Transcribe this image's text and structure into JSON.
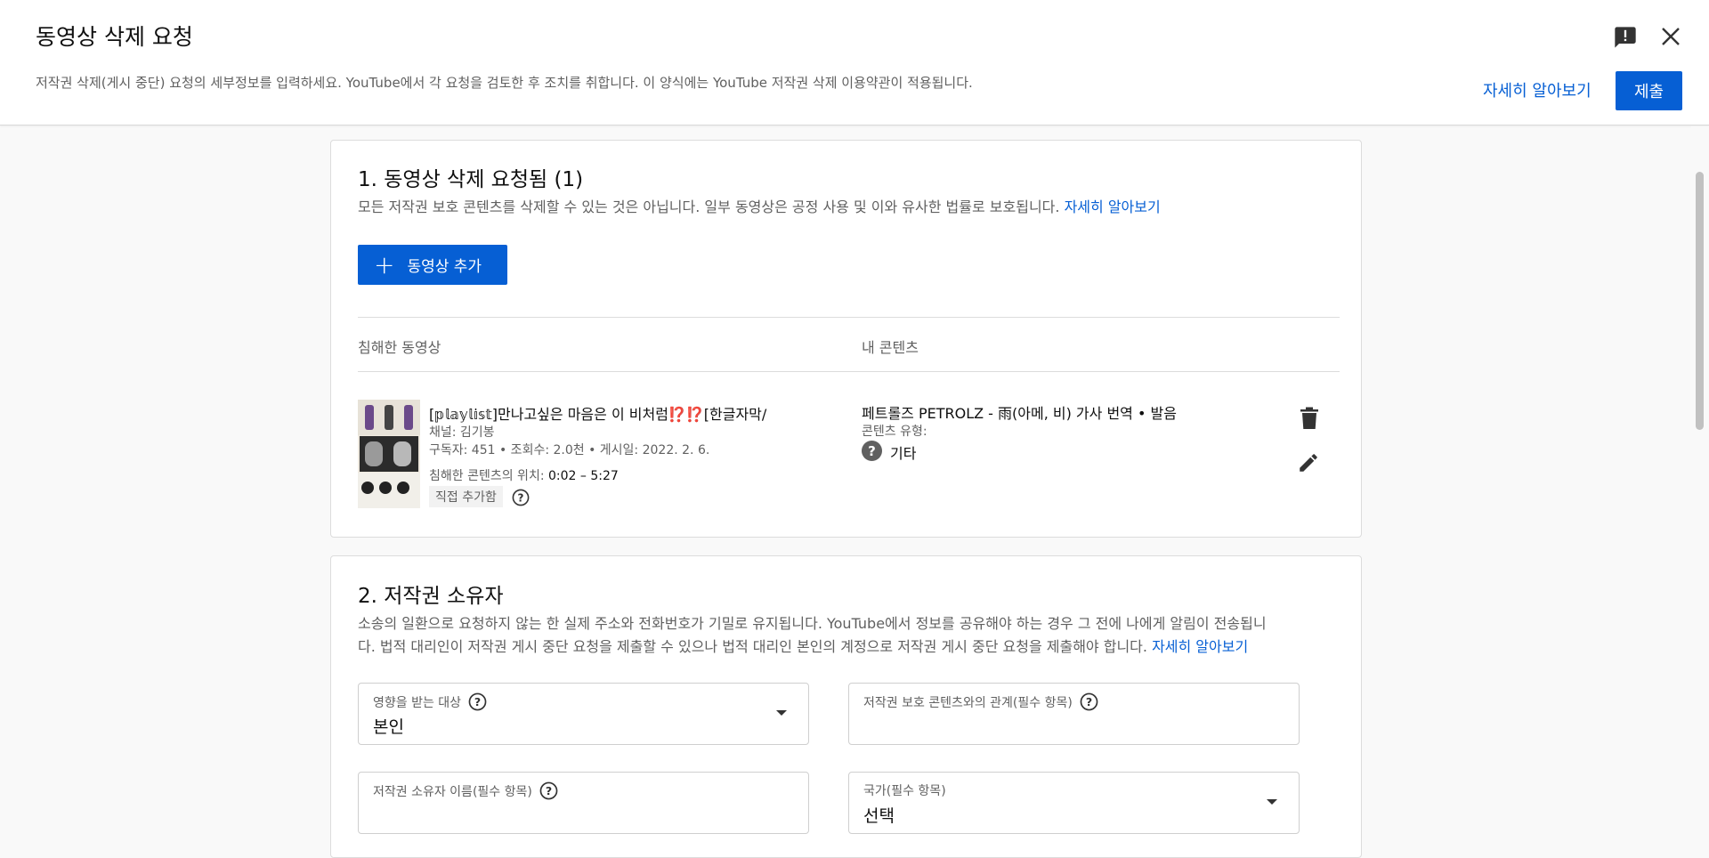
{
  "header": {
    "title": "동영상 삭제 요청",
    "description": "저작권 삭제(게시 중단) 요청의 세부정보를 입력하세요. YouTube에서 각 요청을 검토한 후 조치를 취합니다. 이 양식에는 YouTube 저작권 삭제 이용약관이 적용됩니다.",
    "learn_more": "자세히 알아보기",
    "submit": "제출",
    "icons": {
      "feedback": "feedback-icon",
      "close": "close-icon"
    }
  },
  "section1": {
    "title": "1. 동영상 삭제 요청됨 (1)",
    "description": "모든 저작권 보호 콘텐츠를 삭제할 수 있는 것은 아닙니다. 일부 동영상은 공정 사용 및 이와 유사한 법률로 보호됩니다.",
    "learn_more": "자세히 알아보기",
    "add_video": "동영상 추가",
    "col_infringing": "침해한 동영상",
    "col_my_content": "내 콘텐츠",
    "video": {
      "title": "[𝕡𝕝𝕒𝕪𝕝𝕚𝕤𝕥]만나고싶은 마음은 이 비처럼⁉️⁉️[한글자막/",
      "channel": "채널: 김기봉",
      "stats": "구독자: 451 • 조회수: 2.0천 • 게시일: 2022. 2. 6.",
      "location_label": "침해한 콘텐츠의 위치:",
      "location_value": "0:02 – 5:27",
      "chip": "직접 추가함"
    },
    "my_content": {
      "title": "페트롤즈 PETROLZ - 雨(아메, 비) 가사 번역 • 발음",
      "type_label": "콘텐츠 유형:",
      "type_value": "기타"
    }
  },
  "section2": {
    "title": "2. 저작권 소유자",
    "description_line1": "소송의 일환으로 요청하지 않는 한 실제 주소와 전화번호가 기밀로 유지됩니다. YouTube에서 정보를 공유해야 하는 경우 그 전에 나에게 알림이 전송됩니",
    "description_line2": "다. 법적 대리인이 저작권 게시 중단 요청을 제출할 수 있으나 법적 대리인 본인의 계정으로 저작권 게시 중단 요청을 제출해야 합니다.",
    "learn_more": "자세히 알아보기",
    "fields": {
      "affected": {
        "label": "영향을 받는 대상",
        "value": "본인"
      },
      "relationship": {
        "label": "저작권 보호 콘텐츠와의 관계(필수 항목)",
        "value": ""
      },
      "owner_name": {
        "label": "저작권 소유자 이름(필수 항목)",
        "value": ""
      },
      "country": {
        "label": "국가(필수 항목)",
        "value": "선택"
      }
    }
  },
  "colors": {
    "accent": "#065fd4",
    "text": "#0f0f0f",
    "secondary": "#606060"
  }
}
